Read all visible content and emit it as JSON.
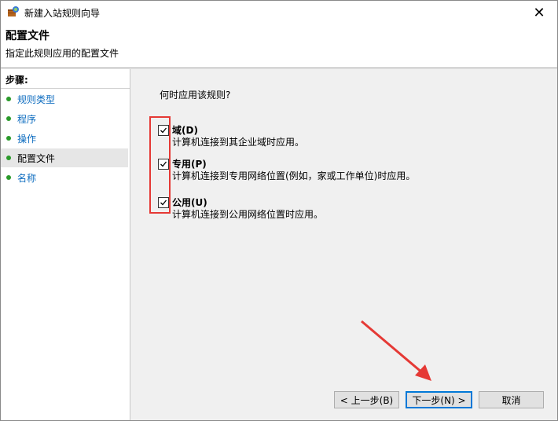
{
  "window": {
    "title": "新建入站规则向导",
    "close_glyph": "✕"
  },
  "header": {
    "title": "配置文件",
    "subtitle": "指定此规则应用的配置文件"
  },
  "sidebar": {
    "steps_title": "步骤:",
    "items": [
      {
        "label": "规则类型"
      },
      {
        "label": "程序"
      },
      {
        "label": "操作"
      },
      {
        "label": "配置文件"
      },
      {
        "label": "名称"
      }
    ],
    "active_index": 3
  },
  "main": {
    "question": "何时应用该规则?",
    "options": [
      {
        "name": "域(D)",
        "desc": "计算机连接到其企业域时应用。",
        "checked": true
      },
      {
        "name": "专用(P)",
        "desc": "计算机连接到专用网络位置(例如，家或工作单位)时应用。",
        "checked": true
      },
      {
        "name": "公用(U)",
        "desc": "计算机连接到公用网络位置时应用。",
        "checked": true
      }
    ]
  },
  "buttons": {
    "back": "< 上一步(B)",
    "next": "下一步(N) >",
    "cancel": "取消"
  },
  "colors": {
    "annotation": "#e53935",
    "link": "#0b6bbf",
    "step_dot": "#2a9a2a"
  }
}
